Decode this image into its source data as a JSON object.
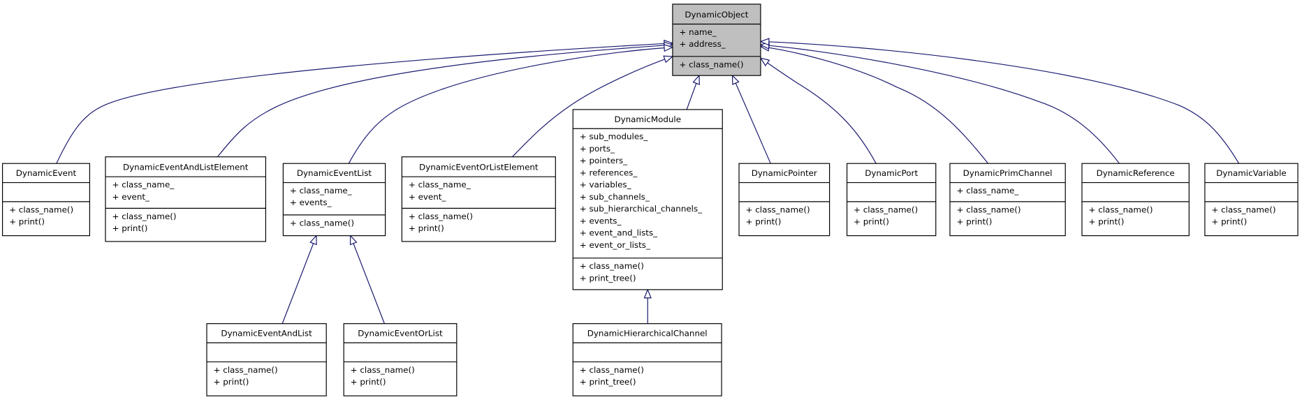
{
  "diagram": {
    "edge_color": "#191970",
    "root_fill": "#bfbfbf",
    "arrow": "hollow-triangle-inheritance",
    "classes": [
      {
        "name": "DynamicObject",
        "attributes": [
          "+ name_",
          "+ address_"
        ],
        "methods": [
          "+ class_name()"
        ],
        "parent": null,
        "highlighted": true
      },
      {
        "name": "DynamicEvent",
        "attributes": [],
        "methods": [
          "+ class_name()",
          "+ print()"
        ],
        "parent": "DynamicObject"
      },
      {
        "name": "DynamicEventAndListElement",
        "attributes": [
          "+ class_name_",
          "+ event_"
        ],
        "methods": [
          "+ class_name()",
          "+ print()"
        ],
        "parent": "DynamicObject"
      },
      {
        "name": "DynamicEventList",
        "attributes": [
          "+ class_name_",
          "+ events_"
        ],
        "methods": [
          "+ class_name()"
        ],
        "parent": "DynamicObject"
      },
      {
        "name": "DynamicEventOrListElement",
        "attributes": [
          "+ class_name_",
          "+ event_"
        ],
        "methods": [
          "+ class_name()",
          "+ print()"
        ],
        "parent": "DynamicObject"
      },
      {
        "name": "DynamicModule",
        "attributes": [
          "+ sub_modules_",
          "+ ports_",
          "+ pointers_",
          "+ references_",
          "+ variables_",
          "+ sub_channels_",
          "+ sub_hierarchical_channels_",
          "+ events_",
          "+ event_and_lists_",
          "+ event_or_lists_"
        ],
        "methods": [
          "+ class_name()",
          "+ print_tree()"
        ],
        "parent": "DynamicObject"
      },
      {
        "name": "DynamicPointer",
        "attributes": [],
        "methods": [
          "+ class_name()",
          "+ print()"
        ],
        "parent": "DynamicObject"
      },
      {
        "name": "DynamicPort",
        "attributes": [],
        "methods": [
          "+ class_name()",
          "+ print()"
        ],
        "parent": "DynamicObject"
      },
      {
        "name": "DynamicPrimChannel",
        "attributes": [
          "+ class_name_"
        ],
        "methods": [
          "+ class_name()",
          "+ print()"
        ],
        "parent": "DynamicObject"
      },
      {
        "name": "DynamicReference",
        "attributes": [],
        "methods": [
          "+ class_name()",
          "+ print()"
        ],
        "parent": "DynamicObject"
      },
      {
        "name": "DynamicVariable",
        "attributes": [],
        "methods": [
          "+ class_name()",
          "+ print()"
        ],
        "parent": "DynamicObject"
      },
      {
        "name": "DynamicEventAndList",
        "attributes": [],
        "methods": [
          "+ class_name()",
          "+ print()"
        ],
        "parent": "DynamicEventList"
      },
      {
        "name": "DynamicEventOrList",
        "attributes": [],
        "methods": [
          "+ class_name()",
          "+ print()"
        ],
        "parent": "DynamicEventList"
      },
      {
        "name": "DynamicHierarchicalChannel",
        "attributes": [],
        "methods": [
          "+ class_name()",
          "+ print_tree()"
        ],
        "parent": "DynamicModule"
      }
    ]
  }
}
